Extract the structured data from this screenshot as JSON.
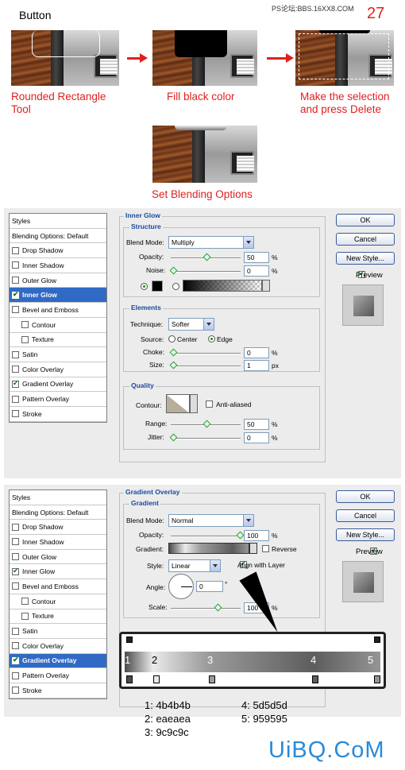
{
  "header": {
    "title": "Button",
    "watermark": "PS论坛:BBS.16XX8.COM",
    "number": "27"
  },
  "steps": [
    {
      "caption": "Rounded Rectangle Tool"
    },
    {
      "caption": "Fill black color"
    },
    {
      "caption": "Make the selection and press Delete"
    },
    {
      "caption": "Set Blending Options"
    }
  ],
  "dialog1": {
    "styles": [
      "Styles",
      "Blending Options: Default",
      "Drop Shadow",
      "Inner Shadow",
      "Outer Glow",
      "Inner Glow",
      "Bevel and Emboss",
      "Contour",
      "Texture",
      "Satin",
      "Color Overlay",
      "Gradient Overlay",
      "Pattern Overlay",
      "Stroke"
    ],
    "title": "Inner Glow",
    "structure": "Structure",
    "blend_mode_label": "Blend Mode:",
    "blend_mode": "Multiply",
    "opacity_label": "Opacity:",
    "opacity": "50",
    "noise_label": "Noise:",
    "noise": "0",
    "pct": "%",
    "elements": "Elements",
    "technique_label": "Technique:",
    "technique": "Softer",
    "source_label": "Source:",
    "center": "Center",
    "edge": "Edge",
    "choke_label": "Choke:",
    "choke": "0",
    "size_label": "Size:",
    "size": "1",
    "px": "px",
    "quality": "Quality",
    "contour_label": "Contour:",
    "anti_aliased": "Anti-aliased",
    "range_label": "Range:",
    "range": "50",
    "jitter_label": "Jitter:",
    "jitter": "0",
    "ok": "OK",
    "cancel": "Cancel",
    "new_style": "New Style...",
    "preview": "Preview"
  },
  "dialog2": {
    "styles": [
      "Styles",
      "Blending Options: Default",
      "Drop Shadow",
      "Inner Shadow",
      "Outer Glow",
      "Inner Glow",
      "Bevel and Emboss",
      "Contour",
      "Texture",
      "Satin",
      "Color Overlay",
      "Gradient Overlay",
      "Pattern Overlay",
      "Stroke"
    ],
    "title": "Gradient Overlay",
    "gradient_hd": "Gradient",
    "blend_mode_label": "Blend Mode:",
    "blend_mode": "Normal",
    "opacity_label": "Opacity:",
    "opacity": "100",
    "gradient_label": "Gradient:",
    "reverse": "Reverse",
    "style_label": "Style:",
    "style": "Linear",
    "align": "Align with Layer",
    "angle_label": "Angle:",
    "angle": "0",
    "deg": "°",
    "scale_label": "Scale:",
    "scale": "100",
    "pct": "%",
    "ok": "OK",
    "cancel": "Cancel",
    "new_style": "New Style...",
    "preview": "Preview"
  },
  "gradient_editor": {
    "stops": [
      "1",
      "2",
      "3",
      "4",
      "5"
    ]
  },
  "colors": [
    {
      "label": "1: 4b4b4b"
    },
    {
      "label": "2: eaeaea"
    },
    {
      "label": "3: 9c9c9c"
    },
    {
      "label": "4: 5d5d5d"
    },
    {
      "label": "5: 959595"
    }
  ],
  "footer_logo": "UiBQ.CoM"
}
